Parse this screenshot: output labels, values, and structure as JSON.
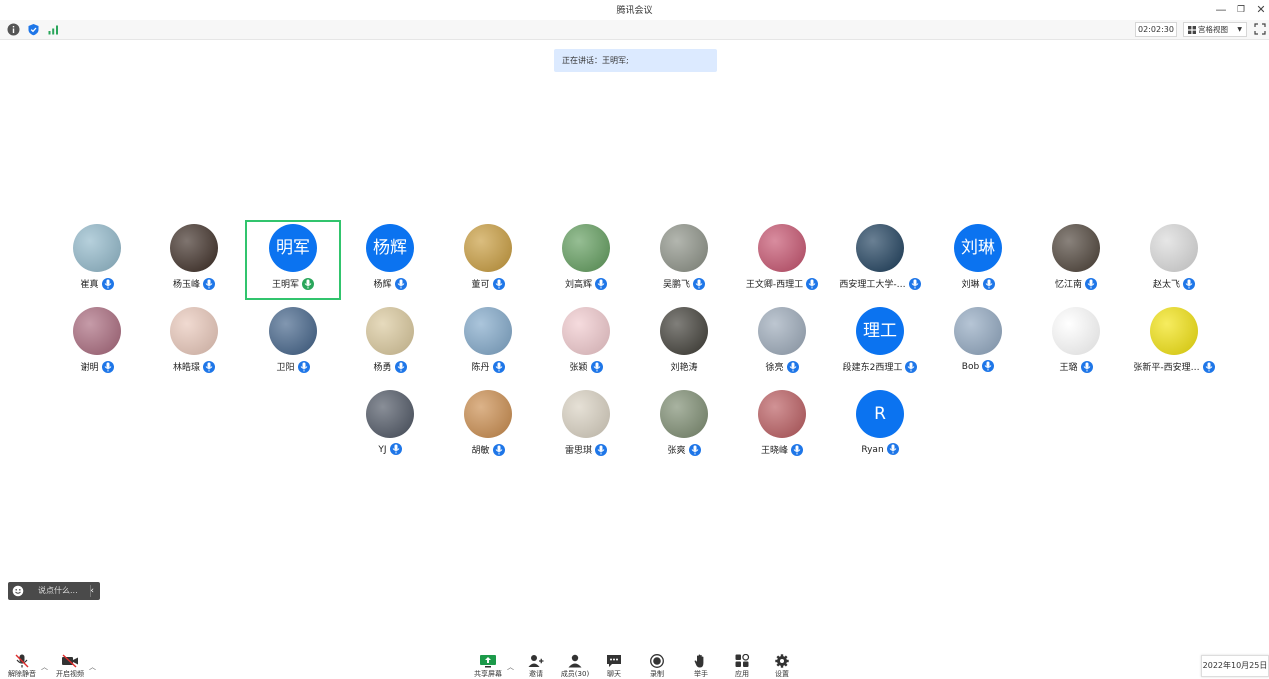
{
  "window": {
    "title": "腾讯会议"
  },
  "toolbar_top": {
    "timer": "02:02:30",
    "view_label": "宫格视图"
  },
  "speaking_banner": {
    "text": "正在讲话：王明军;"
  },
  "participants": [
    {
      "name": "崔真",
      "avatar": "photo",
      "color": "#8fb7c9",
      "mic": "blue"
    },
    {
      "name": "杨玉峰",
      "avatar": "photo",
      "color": "#3a2a22",
      "mic": "blue"
    },
    {
      "name": "王明军",
      "avatar": "text",
      "avatar_text": "明军",
      "mic": "green",
      "active": true
    },
    {
      "name": "杨辉",
      "avatar": "text",
      "avatar_text": "杨辉",
      "mic": "blue"
    },
    {
      "name": "董可",
      "avatar": "photo",
      "color": "#c79a3a",
      "mic": "blue"
    },
    {
      "name": "刘高辉",
      "avatar": "photo",
      "color": "#5e9b5a",
      "mic": "blue"
    },
    {
      "name": "吴鹏飞",
      "avatar": "photo",
      "color": "#8a8f84",
      "mic": "blue"
    },
    {
      "name": "王文卿-西理工",
      "avatar": "photo",
      "color": "#c44f6b",
      "mic": "blue"
    },
    {
      "name": "西安理工大学-…",
      "avatar": "photo",
      "color": "#1a3c5a",
      "mic": "blue"
    },
    {
      "name": "刘琳",
      "avatar": "text",
      "avatar_text": "刘琳",
      "mic": "blue"
    },
    {
      "name": "忆江南",
      "avatar": "photo",
      "color": "#4a3f35",
      "mic": "blue"
    },
    {
      "name": "赵太飞",
      "avatar": "photo",
      "color": "#d9d9d9",
      "mic": "blue"
    },
    {
      "name": "谢明",
      "avatar": "photo",
      "color": "#a7667a",
      "mic": "blue"
    },
    {
      "name": "林皓璟",
      "avatar": "photo",
      "color": "#e8c6b8",
      "mic": "blue"
    },
    {
      "name": "卫阳",
      "avatar": "photo",
      "color": "#3e5f86",
      "mic": "blue"
    },
    {
      "name": "杨勇",
      "avatar": "photo",
      "color": "#d9c79a",
      "mic": "blue"
    },
    {
      "name": "陈丹",
      "avatar": "photo",
      "color": "#7ea6c8",
      "mic": "blue"
    },
    {
      "name": "张颖",
      "avatar": "photo",
      "color": "#f0c8cc",
      "mic": "blue"
    },
    {
      "name": "刘艳涛",
      "avatar": "photo",
      "color": "#3c3a33",
      "mic": "none"
    },
    {
      "name": "徐亮",
      "avatar": "photo",
      "color": "#9aa8b8",
      "mic": "blue"
    },
    {
      "name": "段建东2西理工",
      "avatar": "text",
      "avatar_text": "理工",
      "mic": "blue"
    },
    {
      "name": "Bob",
      "avatar": "photo",
      "color": "#8fa6bf",
      "mic": "blue"
    },
    {
      "name": "王璐",
      "avatar": "photo",
      "color": "#ffffff",
      "mic": "blue"
    },
    {
      "name": "张新平-西安理…",
      "avatar": "photo",
      "color": "#f2e20a",
      "mic": "blue"
    },
    {
      "name": "YJ",
      "avatar": "photo",
      "color": "#4a5260",
      "mic": "blue"
    },
    {
      "name": "胡敏",
      "avatar": "photo",
      "color": "#c98a4a",
      "mic": "blue"
    },
    {
      "name": "雷思琪",
      "avatar": "photo",
      "color": "#d8d0c0",
      "mic": "blue"
    },
    {
      "name": "张爽",
      "avatar": "photo",
      "color": "#7a8a6e",
      "mic": "blue"
    },
    {
      "name": "王晓峰",
      "avatar": "photo",
      "color": "#b8585c",
      "mic": "blue"
    },
    {
      "name": "Ryan",
      "avatar": "text",
      "avatar_text": "R",
      "mic": "blue"
    }
  ],
  "chat_input": {
    "placeholder": "说点什么..."
  },
  "bottom_bar": {
    "mute_label": "解除静音",
    "video_label": "开启视频",
    "share_label": "共享屏幕",
    "invite_label": "邀请",
    "members_label": "成员(30)",
    "chat_label": "聊天",
    "record_label": "录制",
    "raise_label": "举手",
    "apps_label": "应用",
    "settings_label": "设置"
  },
  "taskbar": {
    "date": "2022年10月25日"
  },
  "colors": {
    "accent": "#0b73f0",
    "active_border": "#31c46d",
    "banner_bg": "#dceaff"
  }
}
